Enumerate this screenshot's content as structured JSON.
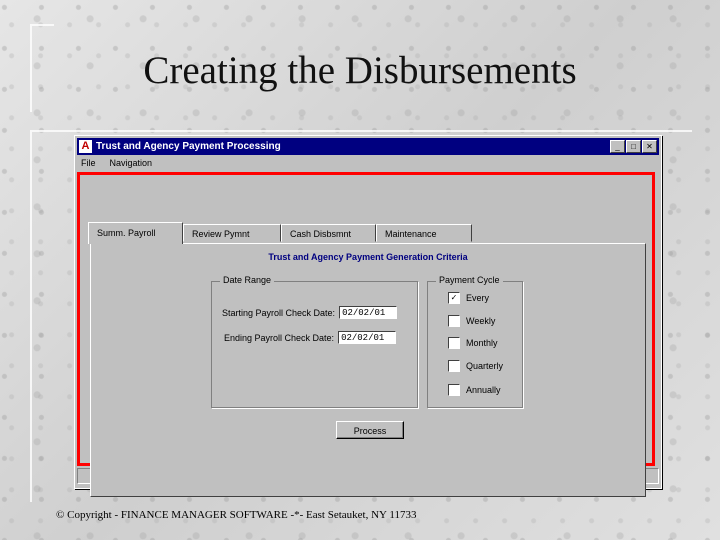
{
  "slide": {
    "title": "Creating the Disbursements",
    "copyright": "© Copyright - FINANCE MANAGER SOFTWARE -*- East Setauket, NY 11733"
  },
  "window": {
    "icon_letter": "A",
    "title": "Trust and Agency Payment Processing",
    "buttons": {
      "minimize": "_",
      "maximize": "□",
      "close": "✕"
    }
  },
  "menu": [
    "File",
    "Navigation"
  ],
  "tabs": [
    "Summ. Payroll",
    "Review Pymnt",
    "Cash Disbsmnt",
    "Maintenance"
  ],
  "panel": {
    "heading": "Trust and Agency Payment Generation Criteria",
    "date_range": {
      "label": "Date Range",
      "start_label": "Starting Payroll Check Date:",
      "start_value": "02/02/01",
      "end_label": "Ending Payroll Check Date:",
      "end_value": "02/02/01"
    },
    "payment_cycle": {
      "label": "Payment Cycle",
      "options": [
        {
          "label": "Every",
          "checked": "✓"
        },
        {
          "label": "Weekly",
          "checked": ""
        },
        {
          "label": "Monthly",
          "checked": ""
        },
        {
          "label": "Quarterly",
          "checked": ""
        },
        {
          "label": "Annually",
          "checked": ""
        }
      ]
    },
    "process_button": "Process"
  }
}
